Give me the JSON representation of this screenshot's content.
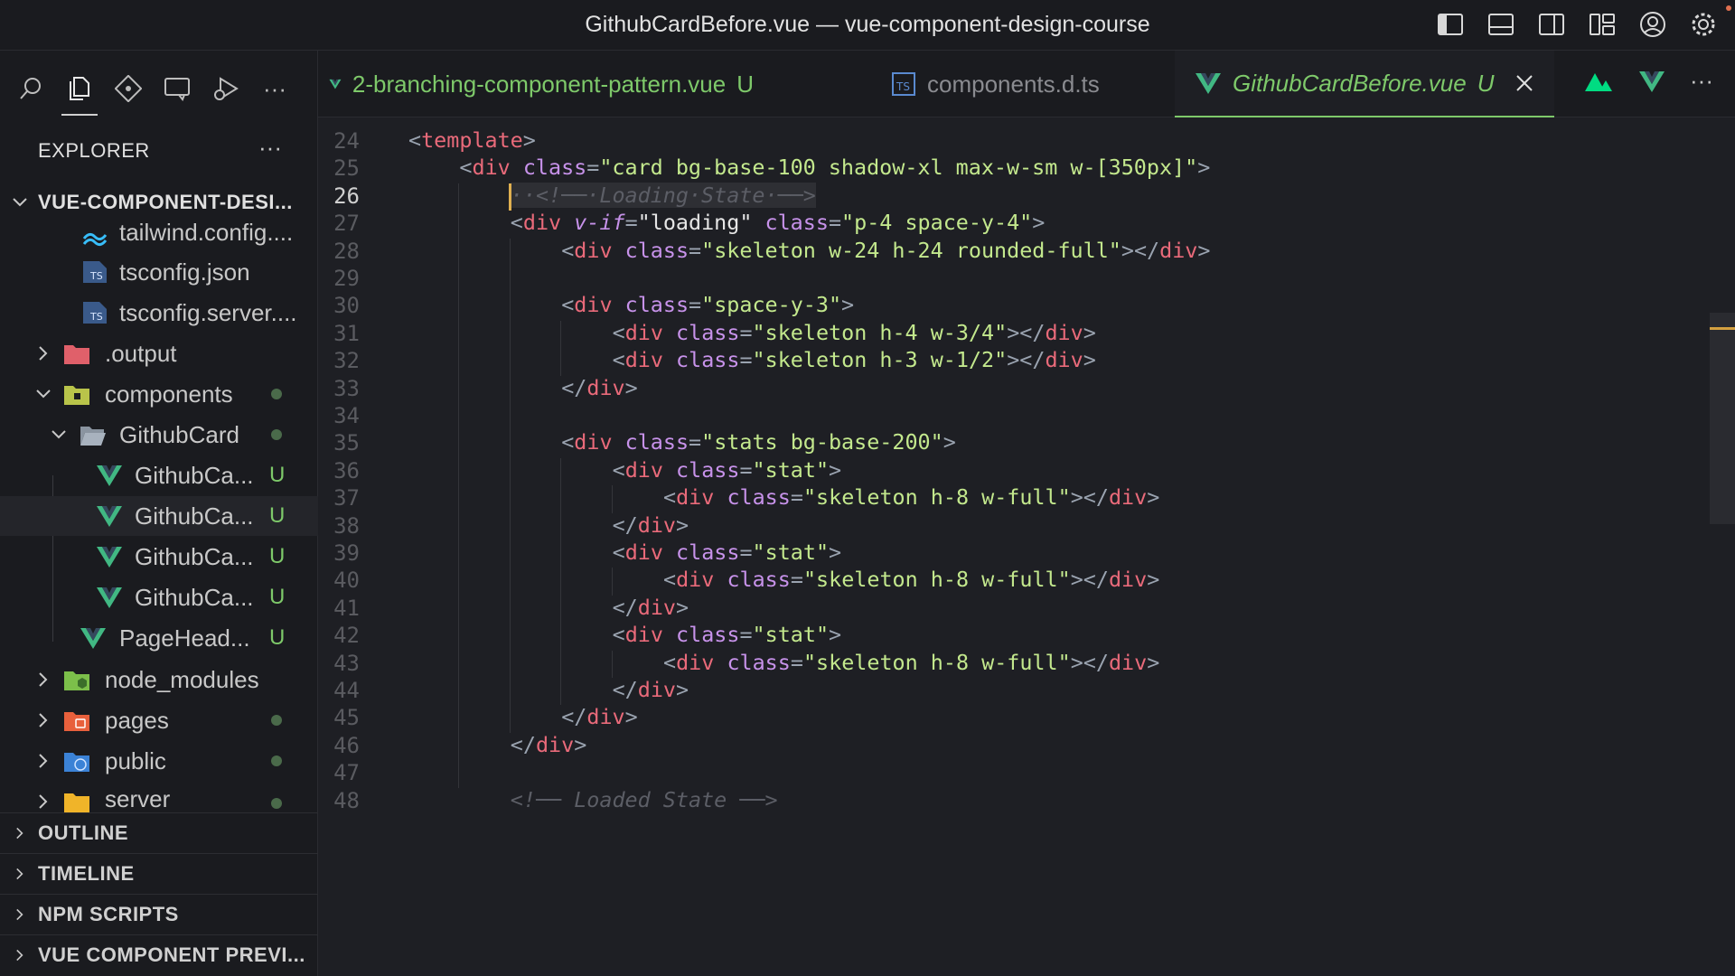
{
  "window": {
    "title": "GithubCardBefore.vue — vue-component-design-course"
  },
  "titlebar_icons": [
    "toggle-primary-sidebar-icon",
    "toggle-panel-icon",
    "toggle-secondary-sidebar-icon",
    "customize-layout-icon",
    "account-icon",
    "settings-gear-icon"
  ],
  "sidebar": {
    "activity": [
      "search-icon",
      "explorer-icon",
      "source-control-icon",
      "remote-explorer-icon",
      "run-debug-icon"
    ],
    "more": "···",
    "explorer_title": "EXPLORER",
    "explorer_more": "···",
    "root": "VUE-COMPONENT-DESI...",
    "tree": [
      {
        "label": "tailwind.config....",
        "icon": "tailwind-icon",
        "color": "#8a8a8a"
      },
      {
        "label": "tsconfig.json",
        "icon": "ts-file-icon",
        "color": "#8a8a8a"
      },
      {
        "label": "tsconfig.server....",
        "icon": "ts-file-icon",
        "color": "#8a8a8a"
      },
      {
        "label": ".output",
        "icon": "folder-output-icon",
        "color": "#8a8a8a"
      },
      {
        "label": "components",
        "icon": "folder-components-icon",
        "color": "#b9c978"
      },
      {
        "label": "GithubCard",
        "icon": "folder-open-icon",
        "color": "#b9c978"
      },
      {
        "label": "GithubCa...",
        "icon": "vue-file-icon",
        "color": "#7ec96a",
        "mark": "U"
      },
      {
        "label": "GithubCa...",
        "icon": "vue-file-icon",
        "color": "#7ec96a",
        "mark": "U"
      },
      {
        "label": "GithubCa...",
        "icon": "vue-file-icon",
        "color": "#7ec96a",
        "mark": "U"
      },
      {
        "label": "GithubCa...",
        "icon": "vue-file-icon",
        "color": "#7ec96a",
        "mark": "U"
      },
      {
        "label": "PageHead...",
        "icon": "vue-file-icon",
        "color": "#7ec96a",
        "mark": "U"
      },
      {
        "label": "node_modules",
        "icon": "folder-node-icon",
        "color": "#8a8a8a"
      },
      {
        "label": "pages",
        "icon": "folder-pages-icon",
        "color": "#b9c978"
      },
      {
        "label": "public",
        "icon": "folder-public-icon",
        "color": "#b9c978"
      },
      {
        "label": "server",
        "icon": "folder-server-icon",
        "color": "#b9c978"
      }
    ],
    "panels": [
      "OUTLINE",
      "TIMELINE",
      "NPM SCRIPTS",
      "VUE COMPONENT PREVI..."
    ]
  },
  "tabs": [
    {
      "label": "2-branching-component-pattern.vue",
      "mark": "U",
      "icon": "vue-file-icon"
    },
    {
      "label": "components.d.ts",
      "mark": "",
      "icon": "ts-file-icon"
    },
    {
      "label": "GithubCardBefore.vue",
      "mark": "U",
      "icon": "vue-file-icon",
      "active": true
    }
  ],
  "tab_actions": [
    "nuxt-icon",
    "vue-devtools-icon",
    "more-actions-icon"
  ],
  "tab_more": "···",
  "editor": {
    "current_line": 26,
    "lines": [
      {
        "n": 24,
        "text": "<template>"
      },
      {
        "n": 25,
        "text": "<div class=\"card bg-base-100 shadow-xl max-w-sm w-[350px]\">"
      },
      {
        "n": 26,
        "text": "··<!──·Loading·State·──>"
      },
      {
        "n": 27,
        "text": "<div v-if=\"loading\" class=\"p-4 space-y-4\">"
      },
      {
        "n": 28,
        "text": "<div class=\"skeleton w-24 h-24 rounded-full\"></div>"
      },
      {
        "n": 29,
        "text": ""
      },
      {
        "n": 30,
        "text": "<div class=\"space-y-3\">"
      },
      {
        "n": 31,
        "text": "<div class=\"skeleton h-4 w-3/4\"></div>"
      },
      {
        "n": 32,
        "text": "<div class=\"skeleton h-3 w-1/2\"></div>"
      },
      {
        "n": 33,
        "text": "</div>"
      },
      {
        "n": 34,
        "text": ""
      },
      {
        "n": 35,
        "text": "<div class=\"stats bg-base-200\">"
      },
      {
        "n": 36,
        "text": "<div class=\"stat\">"
      },
      {
        "n": 37,
        "text": "<div class=\"skeleton h-8 w-full\"></div>"
      },
      {
        "n": 38,
        "text": "</div>"
      },
      {
        "n": 39,
        "text": "<div class=\"stat\">"
      },
      {
        "n": 40,
        "text": "<div class=\"skeleton h-8 w-full\"></div>"
      },
      {
        "n": 41,
        "text": "</div>"
      },
      {
        "n": 42,
        "text": "<div class=\"stat\">"
      },
      {
        "n": 43,
        "text": "<div class=\"skeleton h-8 w-full\"></div>"
      },
      {
        "n": 44,
        "text": "</div>"
      },
      {
        "n": 45,
        "text": "</div>"
      },
      {
        "n": 46,
        "text": "</div>"
      },
      {
        "n": 47,
        "text": ""
      },
      {
        "n": 48,
        "text": "<!── Loaded State ──>"
      }
    ]
  },
  "colors": {
    "accent": "#7ec96a",
    "tag": "#e96a7a",
    "attr": "#c792ea",
    "string": "#c3e88d",
    "comment": "#5c5e66",
    "cursor": "#e0b050"
  }
}
